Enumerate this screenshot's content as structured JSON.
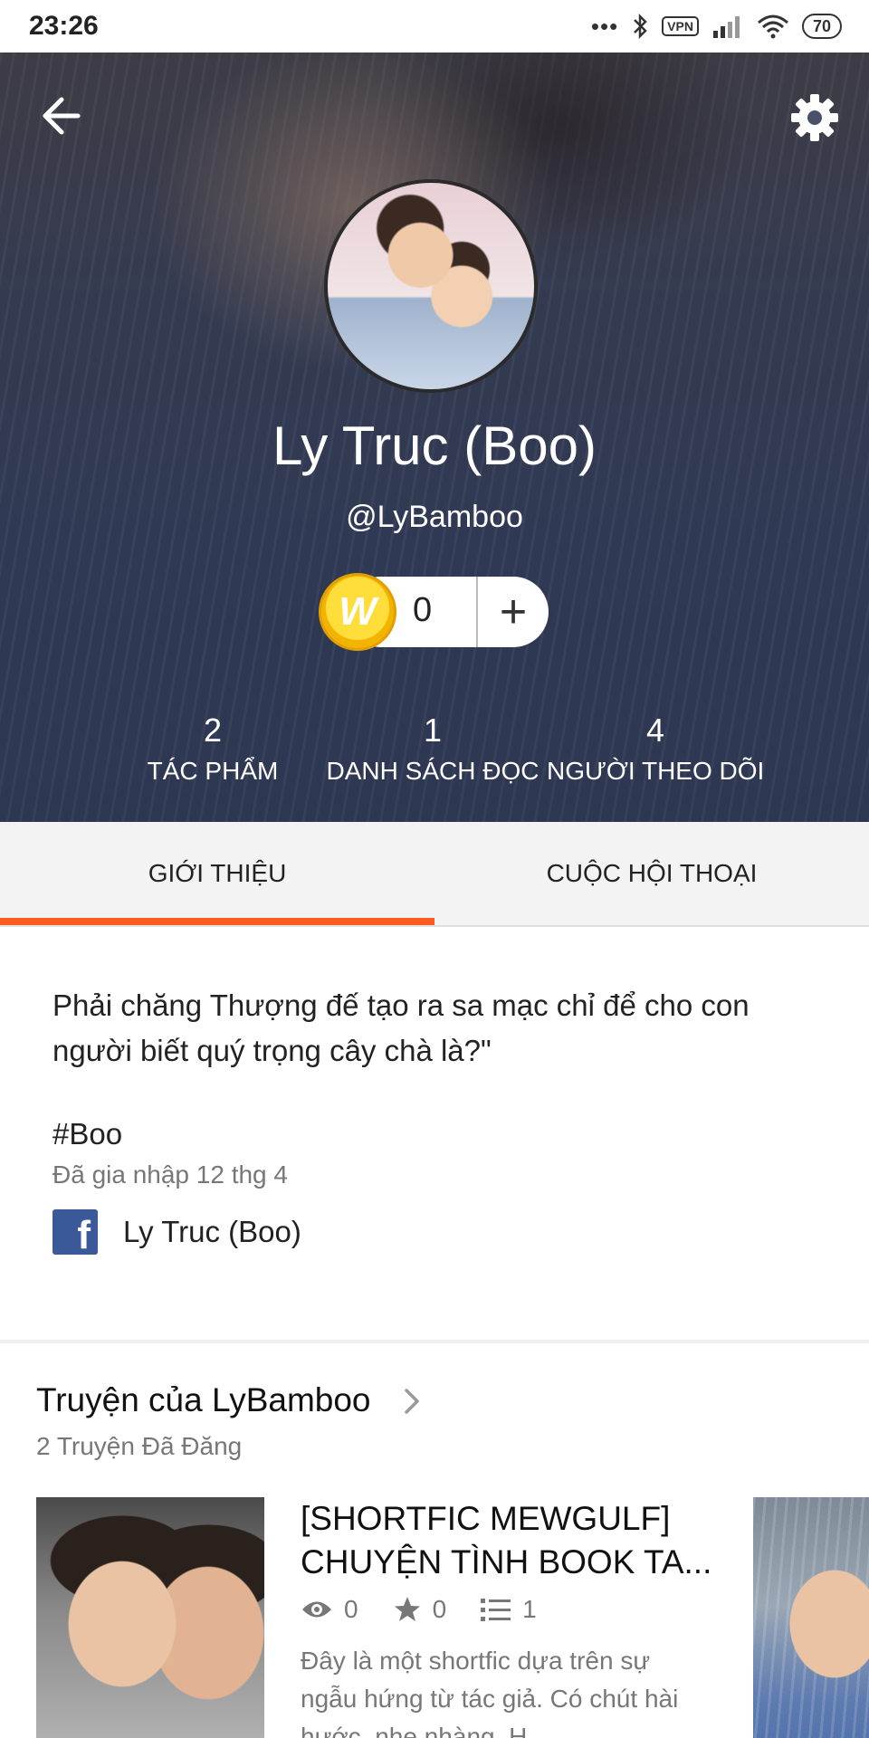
{
  "status_bar": {
    "time": "23:26",
    "dots": "•••",
    "vpn": "VPN",
    "battery": "70"
  },
  "profile": {
    "display_name": "Ly Truc (Boo)",
    "username": "@LyBamboo",
    "coins": "0",
    "coin_symbol": "W",
    "plus": "+",
    "stats": [
      {
        "value": "2",
        "label": "TÁC PHẨM"
      },
      {
        "value": "1",
        "label": "DANH SÁCH ĐỌC"
      },
      {
        "value": "4",
        "label": "NGƯỜI THEO DÕI"
      }
    ]
  },
  "tabs": [
    {
      "label": "GIỚI THIỆU",
      "active": true
    },
    {
      "label": "CUỘC HỘI THOẠI",
      "active": false
    }
  ],
  "about": {
    "bio": "Phải chăng Thượng đế tạo ra sa mạc chỉ để cho con người biết quý trọng cây chà là?\"",
    "hashtag": "#Boo",
    "joined": "Đã gia nhập 12 thg 4",
    "facebook_name": "Ly Truc (Boo)"
  },
  "stories": {
    "title": "Truyện của LyBamboo",
    "count": "2 Truyện Đã Đăng",
    "items": [
      {
        "title_line1": "[SHORTFIC MEWGULF]",
        "title_line2": "CHUYỆN TÌNH BOOK TA...",
        "views": "0",
        "votes": "0",
        "parts": "1",
        "description": "Đây là một shortfic dựa trên sự ngẫu hứng từ tác giả. Có chút hài hước, nhẹ nhàng. H..."
      }
    ]
  },
  "colors": {
    "accent": "#ff5a1f",
    "facebook": "#3b5998",
    "coin": "#ffd21f"
  }
}
